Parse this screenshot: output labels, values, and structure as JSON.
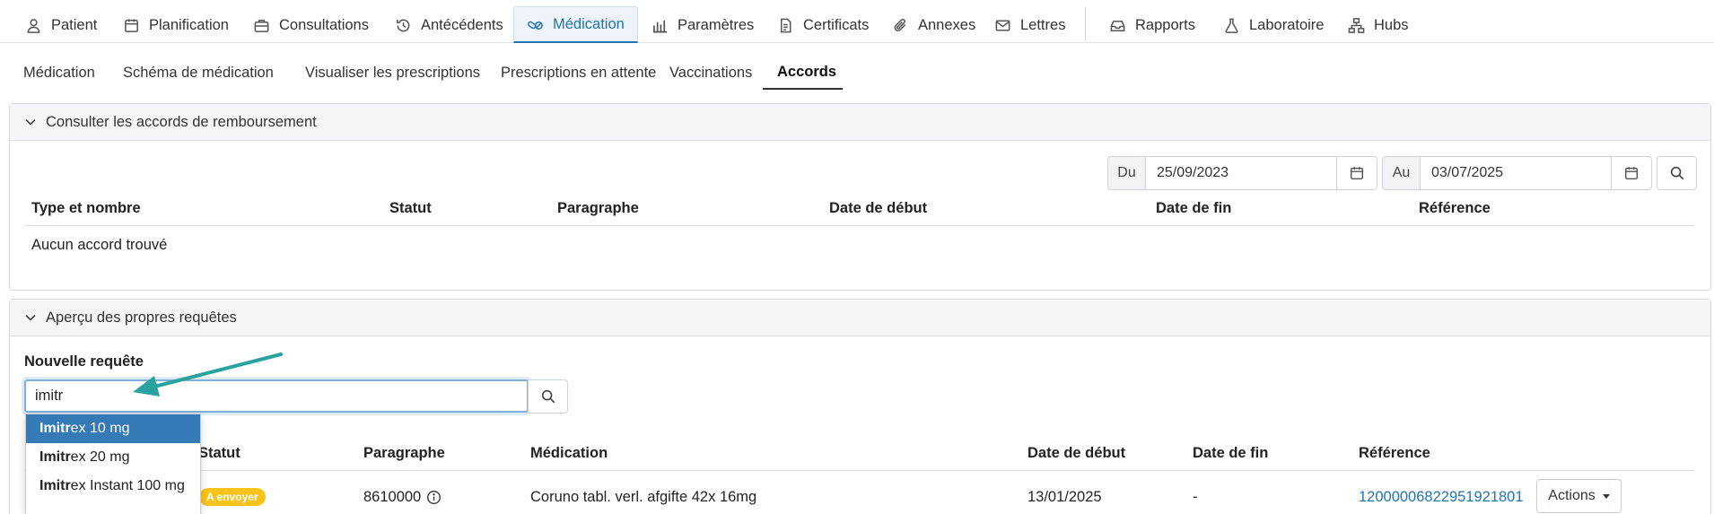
{
  "nav": {
    "items": [
      {
        "label": "Patient",
        "icon": "person-icon"
      },
      {
        "label": "Planification",
        "icon": "calendar-icon"
      },
      {
        "label": "Consultations",
        "icon": "briefcase-icon"
      },
      {
        "label": "Antécédents",
        "icon": "history-icon"
      },
      {
        "label": "Médication",
        "icon": "pills-icon"
      },
      {
        "label": "Paramètres",
        "icon": "bar-chart-icon"
      },
      {
        "label": "Certificats",
        "icon": "document-icon"
      },
      {
        "label": "Annexes",
        "icon": "paperclip-icon"
      },
      {
        "label": "Lettres",
        "icon": "letter-icon"
      },
      {
        "label": "Rapports",
        "icon": "inbox-icon"
      },
      {
        "label": "Laboratoire",
        "icon": "flask-icon"
      },
      {
        "label": "Hubs",
        "icon": "network-icon"
      }
    ],
    "active_index": 4
  },
  "subtabs": {
    "items": [
      "Médication",
      "Schéma de médication",
      "Visualiser les prescriptions",
      "Prescriptions en attente",
      "Vaccinations",
      "Accords"
    ],
    "active_index": 5
  },
  "reimbursement": {
    "title": "Consulter les accords de remboursement",
    "from_label": "Du",
    "from_date": "25/09/2023",
    "to_label": "Au",
    "to_date": "03/07/2025",
    "columns": [
      "Type et nombre",
      "Statut",
      "Paragraphe",
      "Date de début",
      "Date de fin",
      "Référence"
    ],
    "empty_text": "Aucun accord trouvé"
  },
  "requests": {
    "title": "Aperçu des propres requêtes",
    "new_label": "Nouvelle requête",
    "query_value": "imitr",
    "suggestions": [
      {
        "match": "Imitr",
        "rest": "ex 10 mg"
      },
      {
        "match": "Imitr",
        "rest": "ex 20 mg"
      },
      {
        "match": "Imitr",
        "rest": "ex Instant 100 mg"
      }
    ],
    "columns": [
      "Statut",
      "Paragraphe",
      "Médication",
      "Date de début",
      "Date de fin",
      "Référence"
    ],
    "rows": [
      {
        "status": "A envoyer",
        "paragraph": "8610000",
        "medication": "Coruno tabl. verl. afgifte 42x 16mg",
        "start": "13/01/2025",
        "end": "-",
        "reference": "12000006822951921801",
        "actions": "Actions"
      }
    ]
  },
  "colors": {
    "accent": "#1f73b7",
    "arrow": "#2aa3a0",
    "badge": "#f7c21b",
    "selected": "#337ab7"
  }
}
